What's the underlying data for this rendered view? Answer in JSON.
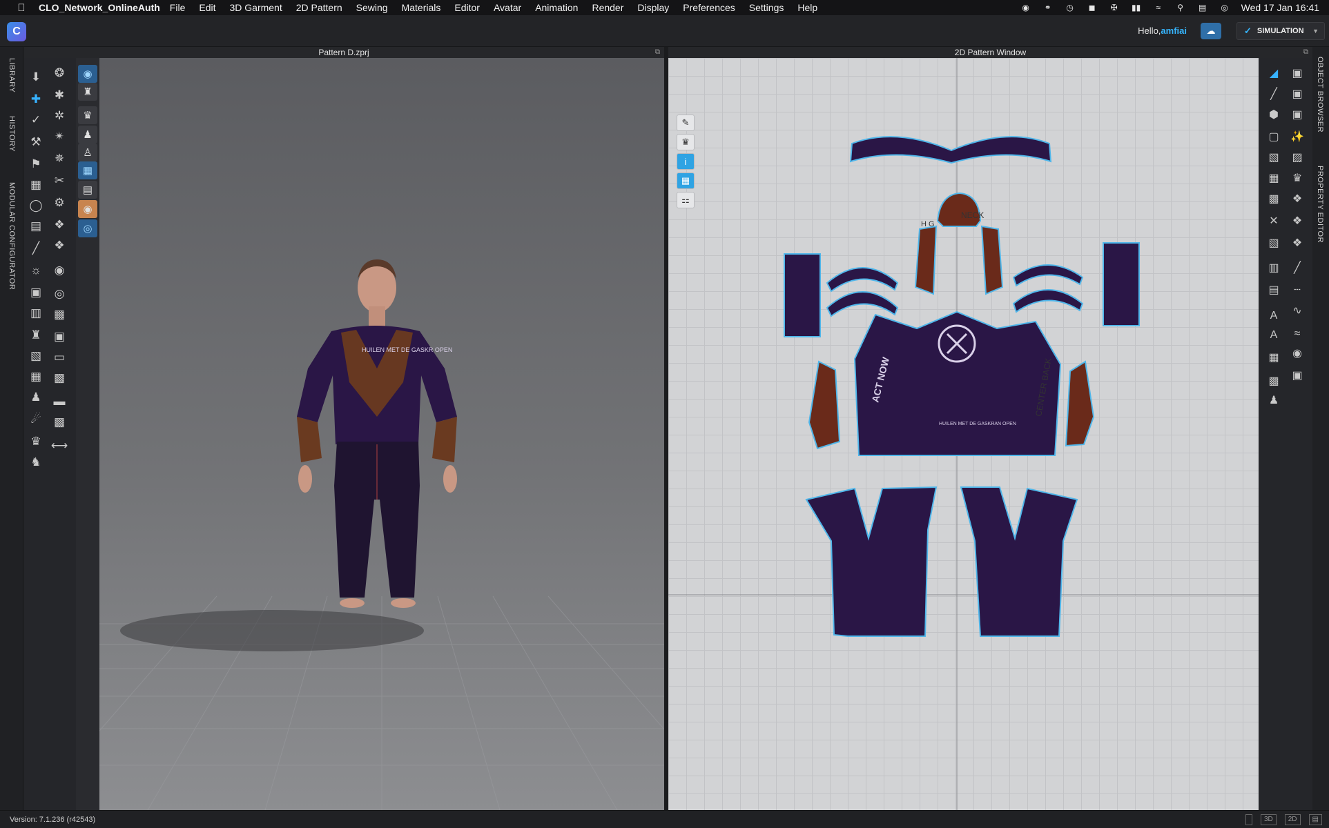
{
  "menubar": {
    "app_name": "CLO_Network_OnlineAuth",
    "menus": [
      "File",
      "Edit",
      "3D Garment",
      "2D Pattern",
      "Sewing",
      "Materials",
      "Editor",
      "Avatar",
      "Animation",
      "Render",
      "Display",
      "Preferences",
      "Settings",
      "Help"
    ],
    "clock": "Wed 17 Jan  16:41"
  },
  "header": {
    "greeting": "Hello,",
    "username": "amfiai",
    "simulation_label": "SIMULATION"
  },
  "left_tabs": {
    "library": "LIBRARY",
    "history": "HISTORY",
    "modular": "MODULAR CONFIGURATOR"
  },
  "right_tabs": {
    "object_browser": "OBJECT BROWSER",
    "property_editor": "PROPERTY EDITOR"
  },
  "panel3d": {
    "title": "Pattern D.zprj"
  },
  "panel2d": {
    "title": "2D Pattern Window",
    "pattern_labels": {
      "neck": "NECK",
      "hg": "H G",
      "center_back": "CENTER BACK",
      "act_now": "ACT NOW",
      "huilen": "HUILEN MET DE GASKRAN OPEN"
    }
  },
  "avatar_shirt_text": "HUILEN MET DE GASKR OPEN",
  "status": {
    "version": "Version: 7.1.236 (r42543)",
    "views": [
      "",
      "3D",
      "2D"
    ]
  },
  "colors": {
    "accent": "#36b6ff",
    "fabric": "#2a1646",
    "brown": "#6a2a1a",
    "outline": "#4fb6ea"
  }
}
